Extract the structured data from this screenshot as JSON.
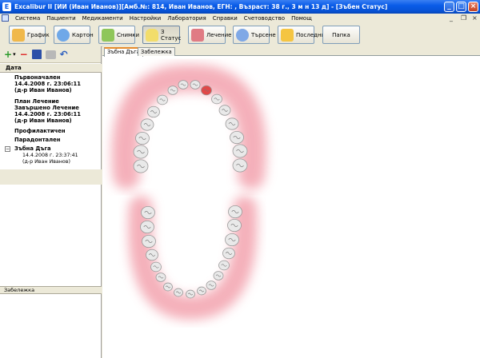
{
  "window": {
    "title": "Excalibur II [ИИ (Иван Иванов)][Амб.№: 814, Иван Иванов, ЕГН: , Възраст: 38 г., 3 м н 13 д] - [Зъбен Статус]",
    "minimize": "_",
    "maximize": "□",
    "close": "×"
  },
  "menu": {
    "items": [
      "Система",
      "Пациенти",
      "Медикаменти",
      "Настройки",
      "Лаборатория",
      "Справки",
      "Счетоводство",
      "Помощ"
    ],
    "mdi_minimize": "_",
    "mdi_restore": "❐",
    "mdi_close": "×"
  },
  "toolbar": {
    "buttons": [
      {
        "label": "График",
        "icon": "calendar-icon",
        "color": "#f0b84a"
      },
      {
        "label": "Картон",
        "icon": "patient-icon",
        "color": "#6fa8e8"
      },
      {
        "label": "Снимки",
        "icon": "xray-icon",
        "color": "#8fc65a"
      },
      {
        "label": "З Статус",
        "icon": "tooth-icon",
        "color": "#f2dd6b"
      },
      {
        "label": "Лечение",
        "icon": "treatment-icon",
        "color": "#e07b84"
      },
      {
        "label": "Търсене",
        "icon": "search-icon",
        "color": "#7fa8e6"
      },
      {
        "label": "Последни",
        "icon": "star-icon",
        "color": "#f5c542"
      },
      {
        "label": "Папка",
        "icon": "",
        "color": ""
      }
    ]
  },
  "left": {
    "tools": {
      "add": "+",
      "add_dropdown": "▾",
      "remove": "−",
      "undo": "↶"
    },
    "tree_header": "Дата",
    "tree": {
      "n1": "Първоначален",
      "n1_line1": "14.4.2008 г. 23:06:11",
      "n1_line2": "(д-р Иван Иванов)",
      "n2": "План Лечение",
      "n3": "Завършено Лечение",
      "n3_line1": "14.4.2008 г. 23:06:11",
      "n3_line2": "(д-р Иван Иванов)",
      "n4": "Профилактичен",
      "n5": "Парадонтален",
      "n6": "Зъбна Дъга",
      "n6_expander": "−",
      "n6_line1": "14.4.2008 г. 23:37:41",
      "n6_line2": "(д-р Иван Иванов)"
    },
    "notes_header": "Забележка"
  },
  "main": {
    "tabs": [
      "Зъбна Дъга",
      "Забележка"
    ],
    "active_tab": "Зъбна Дъга",
    "gum_color": "#f3a3ae",
    "tooth_color": "#e9e9e9",
    "highlight_color": "#e24848"
  }
}
